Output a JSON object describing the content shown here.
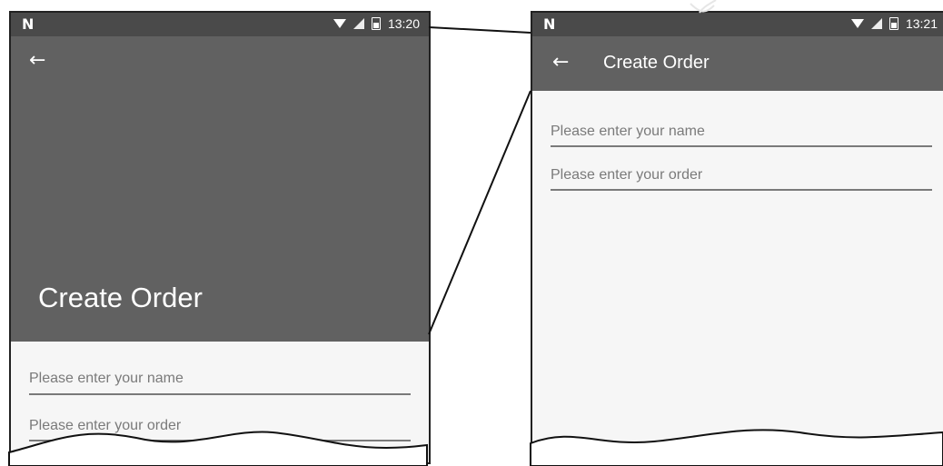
{
  "left_screen": {
    "status_time": "13:20",
    "title": "Create Order",
    "name_placeholder": "Please enter your name",
    "order_placeholder": "Please enter your order"
  },
  "right_screen": {
    "status_time": "13:21",
    "title": "Create Order",
    "name_placeholder": "Please enter your name",
    "order_placeholder": "Please enter your order"
  },
  "icons": {
    "notification": "N",
    "back": "back-arrow-icon",
    "wifi": "wifi-icon",
    "signal": "signal-icon",
    "battery": "battery-icon"
  },
  "colors": {
    "status_bar": "#4a4a4a",
    "app_bar": "#616161",
    "content_bg": "#f6f6f6",
    "hint_text": "#7a7a7a"
  }
}
